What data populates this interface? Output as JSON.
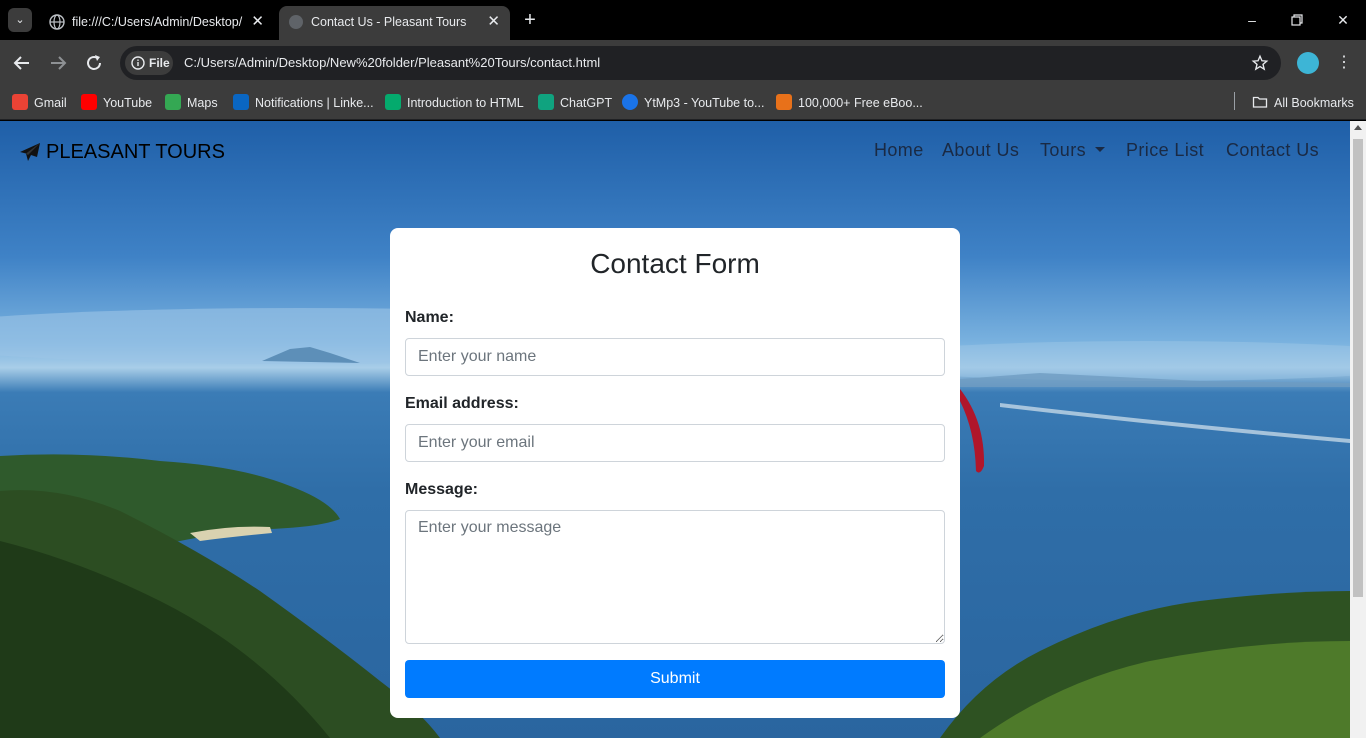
{
  "browser": {
    "tabs": [
      {
        "title": "file:///C:/Users/Admin/Desktop/",
        "active": false
      },
      {
        "title": "Contact Us - Pleasant Tours",
        "active": true
      }
    ],
    "address_chip": "File",
    "url": "C:/Users/Admin/Desktop/New%20folder/Pleasant%20Tours/contact.html",
    "bookmarks": [
      {
        "label": "Gmail",
        "icon": "gmail-icon",
        "color": "#ea4335"
      },
      {
        "label": "YouTube",
        "icon": "youtube-icon",
        "color": "#ff0000"
      },
      {
        "label": "Maps",
        "icon": "maps-icon",
        "color": "#34a853"
      },
      {
        "label": "Notifications | Linke...",
        "icon": "linkedin-icon",
        "color": "#0a66c2"
      },
      {
        "label": "Introduction to HTML",
        "icon": "w3schools-icon",
        "color": "#04aa6d"
      },
      {
        "label": "ChatGPT",
        "icon": "chatgpt-icon",
        "color": "#10a37f"
      },
      {
        "label": "YtMp3 - YouTube to...",
        "icon": "ytmp3-icon",
        "color": "#1a73e8"
      },
      {
        "label": "100,000+ Free eBoo...",
        "icon": "ebook-icon",
        "color": "#e8711a"
      }
    ],
    "all_bookmarks": "All Bookmarks"
  },
  "site": {
    "brand": "PLEASANT TOURS",
    "nav": [
      "Home",
      "About Us",
      "Tours",
      "Price List",
      "Contact Us"
    ]
  },
  "form": {
    "title": "Contact Form",
    "name_label": "Name:",
    "name_placeholder": "Enter your name",
    "email_label": "Email address:",
    "email_placeholder": "Enter your email",
    "message_label": "Message:",
    "message_placeholder": "Enter your message",
    "submit_label": "Submit",
    "accent_color": "#007bff"
  }
}
